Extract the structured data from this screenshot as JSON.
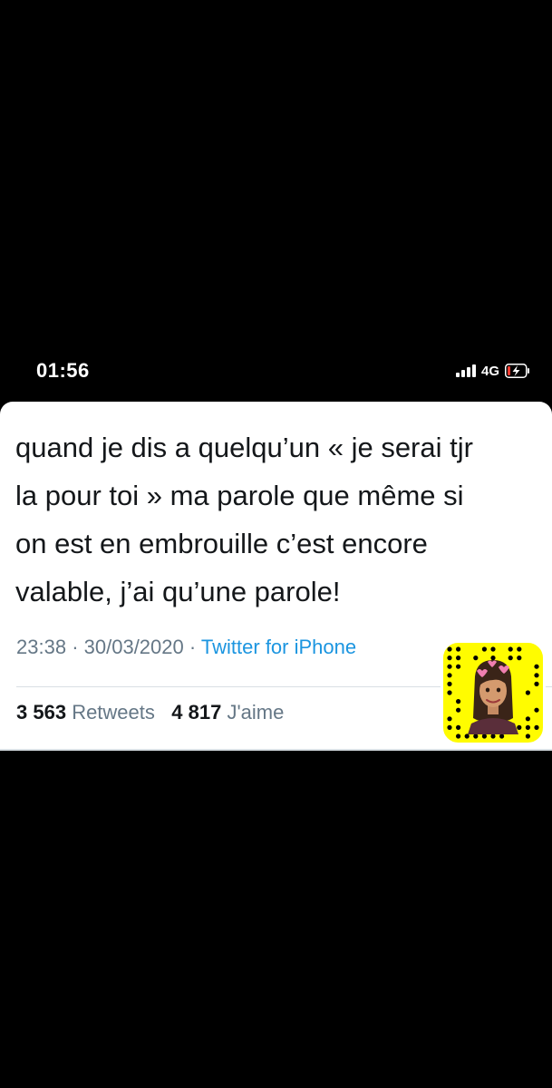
{
  "status_bar": {
    "time": "01:56",
    "network": "4G",
    "colors": {
      "text": "#ffffff",
      "battery_low": "#ff3b30"
    }
  },
  "tweet": {
    "lines": [
      "quand je dis a quelqu’un « je serai tjr",
      "la pour toi » ma parole que même si",
      "on est en embrouille c’est encore",
      "valable, j’ai qu’une parole!"
    ],
    "time": "23:38",
    "separator": "·",
    "date": "30/03/2020",
    "source": "Twitter for iPhone",
    "retweets_count": "3 563",
    "retweets_label": "Retweets",
    "likes_count": "4 817",
    "likes_label": "J'aime",
    "colors": {
      "text": "#14171a",
      "meta": "#657786",
      "link": "#1b95e0",
      "divider": "#d9dfe4"
    }
  },
  "snapcode": {
    "icon": "snapcode-bitmoji-icon",
    "colors": {
      "background": "#fffc00",
      "dots": "#000000"
    }
  }
}
